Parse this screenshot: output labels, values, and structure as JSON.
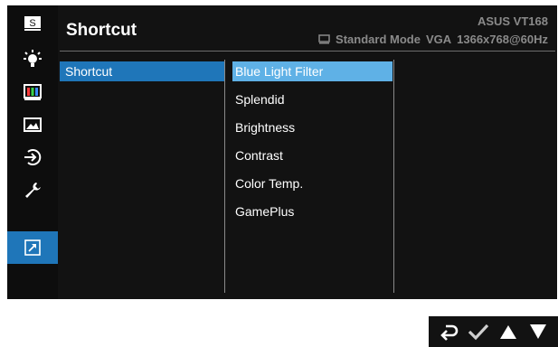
{
  "header": {
    "title": "Shortcut",
    "model": "ASUS VT168",
    "mode": "Standard Mode",
    "input": "VGA",
    "resolution": "1366x768@60Hz"
  },
  "sidebar": {
    "items": [
      {
        "icon": "splendid-icon",
        "label": "S",
        "active": false
      },
      {
        "icon": "blue-light-filter-icon",
        "active": false
      },
      {
        "icon": "color-icon",
        "active": false
      },
      {
        "icon": "image-icon",
        "active": false
      },
      {
        "icon": "input-select-icon",
        "active": false
      },
      {
        "icon": "system-setup-icon",
        "active": false
      },
      {
        "icon": "shortcut-icon",
        "active": true
      }
    ]
  },
  "categories": {
    "selected": "Shortcut"
  },
  "options": [
    {
      "label": "Blue Light Filter",
      "selected": true
    },
    {
      "label": "Splendid",
      "selected": false
    },
    {
      "label": "Brightness",
      "selected": false
    },
    {
      "label": "Contrast",
      "selected": false
    },
    {
      "label": "Color Temp.",
      "selected": false
    },
    {
      "label": "GamePlus",
      "selected": false
    }
  ],
  "footer": {
    "buttons": [
      "back-icon",
      "confirm-icon",
      "up-icon",
      "down-icon"
    ]
  },
  "colors": {
    "accent": "#1f76b9",
    "highlight": "#5fb1e6",
    "background": "#121212"
  }
}
